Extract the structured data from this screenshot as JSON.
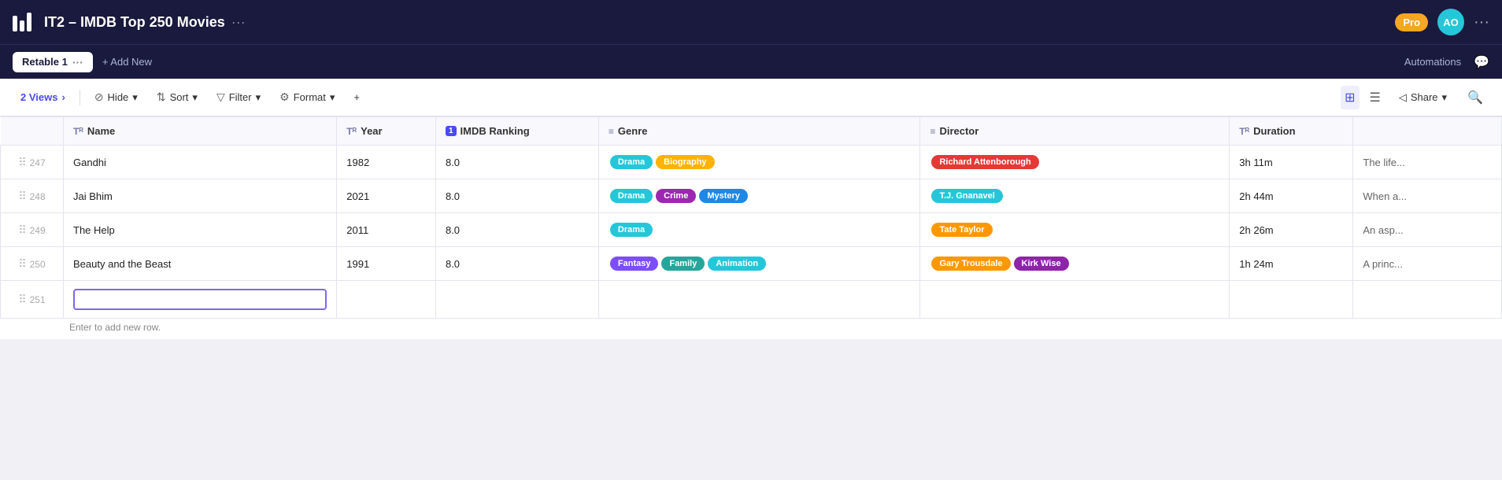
{
  "app": {
    "title": "IT2 – IMDB Top 250 Movies",
    "title_dots": "···",
    "pro_label": "Pro",
    "avatar_initials": "AO",
    "more_label": "···"
  },
  "subnav": {
    "tab_label": "Retable 1",
    "tab_dots": "···",
    "add_new_label": "+ Add New",
    "automations_label": "Automations"
  },
  "toolbar": {
    "views_label": "2 Views",
    "views_chevron": ">",
    "hide_label": "Hide",
    "sort_label": "Sort",
    "filter_label": "Filter",
    "format_label": "Format",
    "plus_label": "+",
    "share_label": "Share",
    "share_chevron": "▾"
  },
  "table": {
    "columns": [
      {
        "id": "name",
        "label": "Name",
        "icon": "T↑"
      },
      {
        "id": "year",
        "label": "Year",
        "icon": "T↑"
      },
      {
        "id": "imdb_ranking",
        "label": "IMDB Ranking",
        "icon": "1"
      },
      {
        "id": "genre",
        "label": "Genre",
        "icon": "≡"
      },
      {
        "id": "director",
        "label": "Director",
        "icon": "≡"
      },
      {
        "id": "duration",
        "label": "Duration",
        "icon": "T↑"
      }
    ],
    "rows": [
      {
        "num": "247",
        "name": "Gandhi",
        "year": "1982",
        "ranking": "8.0",
        "genres": [
          {
            "label": "Drama",
            "cls": "tag-drama"
          },
          {
            "label": "Biography",
            "cls": "tag-biography"
          }
        ],
        "directors": [
          {
            "label": "Richard Attenborough",
            "cls": "dir-red"
          }
        ],
        "duration": "3h 11m",
        "extra": "The life..."
      },
      {
        "num": "248",
        "name": "Jai Bhim",
        "year": "2021",
        "ranking": "8.0",
        "genres": [
          {
            "label": "Drama",
            "cls": "tag-drama"
          },
          {
            "label": "Crime",
            "cls": "tag-crime"
          },
          {
            "label": "Mystery",
            "cls": "tag-mystery"
          }
        ],
        "directors": [
          {
            "label": "T.J. Gnanavel",
            "cls": "dir-teal"
          }
        ],
        "duration": "2h 44m",
        "extra": "When a..."
      },
      {
        "num": "249",
        "name": "The Help",
        "year": "2011",
        "ranking": "8.0",
        "genres": [
          {
            "label": "Drama",
            "cls": "tag-drama"
          }
        ],
        "directors": [
          {
            "label": "Tate Taylor",
            "cls": "dir-orange"
          }
        ],
        "duration": "2h 26m",
        "extra": "An asp..."
      },
      {
        "num": "250",
        "name": "Beauty and the Beast",
        "year": "1991",
        "ranking": "8.0",
        "genres": [
          {
            "label": "Fantasy",
            "cls": "tag-fantasy"
          },
          {
            "label": "Family",
            "cls": "tag-family"
          },
          {
            "label": "Animation",
            "cls": "tag-animation"
          }
        ],
        "directors": [
          {
            "label": "Gary Trousdale",
            "cls": "dir-orange"
          },
          {
            "label": "Kirk Wise",
            "cls": "dir-purple"
          }
        ],
        "duration": "1h 24m",
        "extra": "A princ..."
      }
    ],
    "new_row_num": "251",
    "add_row_hint": "Enter to add new row."
  }
}
